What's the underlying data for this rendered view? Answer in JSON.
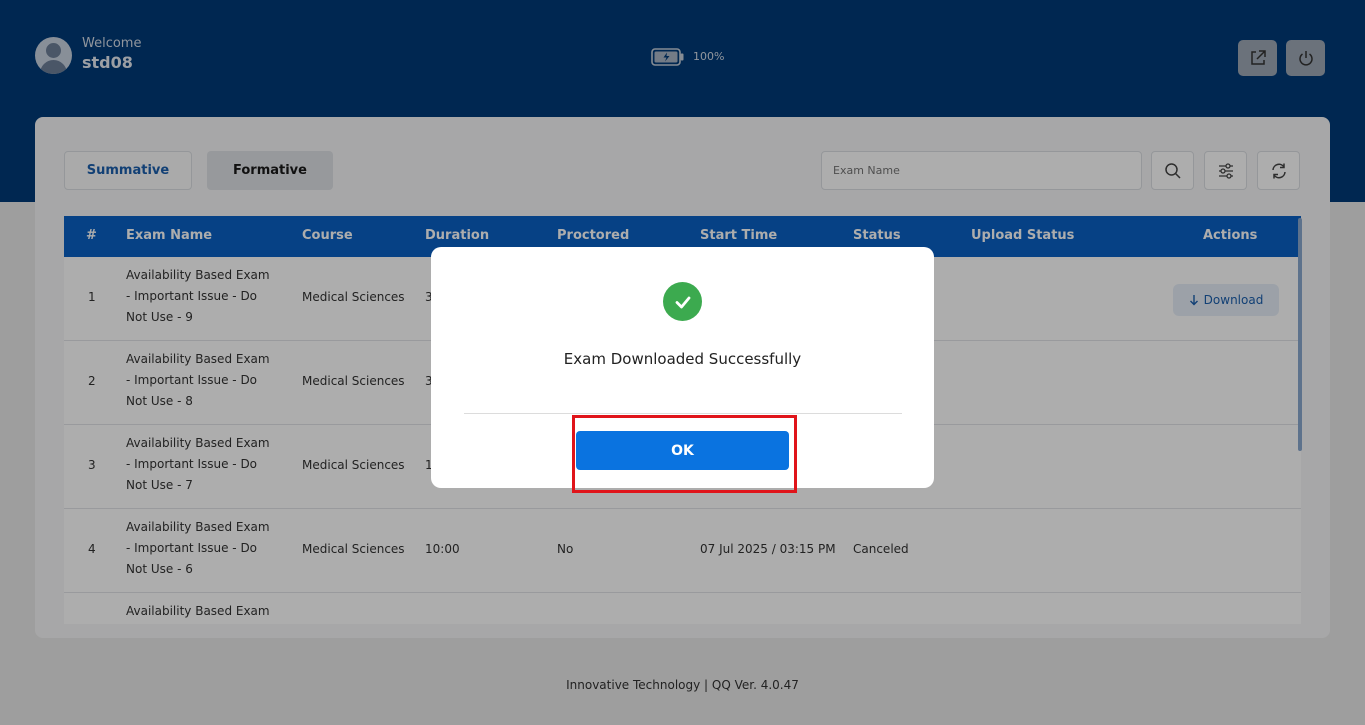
{
  "header": {
    "welcome": "Welcome",
    "username": "std08",
    "battery_percent": "100%"
  },
  "tabs": [
    {
      "label": "Summative",
      "active": true
    },
    {
      "label": "Formative",
      "active": false
    }
  ],
  "search": {
    "placeholder": "Exam Name"
  },
  "table": {
    "columns": [
      "#",
      "Exam Name",
      "Course",
      "Duration",
      "Proctored",
      "Start Time",
      "Status",
      "Upload Status",
      "Actions"
    ],
    "rows": [
      {
        "num": "1",
        "name": "Availability Based Exam - Important Issue - Do Not Use - 9",
        "course": "Medical Sciences",
        "duration": "3",
        "proctored": "",
        "start": "",
        "status": "",
        "upload": "",
        "action": "Download"
      },
      {
        "num": "2",
        "name": "Availability Based Exam - Important Issue - Do Not Use - 8",
        "course": "Medical Sciences",
        "duration": "3",
        "proctored": "",
        "start": "",
        "status": "",
        "upload": "",
        "action": ""
      },
      {
        "num": "3",
        "name": "Availability Based Exam - Important Issue - Do Not Use - 7",
        "course": "Medical Sciences",
        "duration": "1",
        "proctored": "",
        "start": "",
        "status": "",
        "upload": "",
        "action": ""
      },
      {
        "num": "4",
        "name": "Availability Based Exam - Important Issue - Do Not Use - 6",
        "course": "Medical Sciences",
        "duration": "10:00",
        "proctored": "No",
        "start": "07 Jul 2025 / 03:15 PM",
        "status": "Canceled",
        "upload": "",
        "action": ""
      },
      {
        "num": "",
        "name": "Availability Based Exam -",
        "course": "",
        "duration": "",
        "proctored": "",
        "start": "",
        "status": "",
        "upload": "",
        "action": ""
      }
    ]
  },
  "modal": {
    "message": "Exam Downloaded Successfully",
    "ok_label": "OK"
  },
  "footer": {
    "text": "Innovative Technology | QQ Ver. 4.0.47"
  },
  "colors": {
    "header_bg": "#003a78",
    "table_header": "#0a61c4",
    "ok_button": "#0a73e0",
    "success": "#3caa4f",
    "highlight": "#e0141a"
  },
  "icons": {
    "header_buttons": [
      "external-link-icon",
      "power-icon"
    ],
    "tools": [
      "search-icon",
      "filter-icon",
      "refresh-icon"
    ]
  }
}
